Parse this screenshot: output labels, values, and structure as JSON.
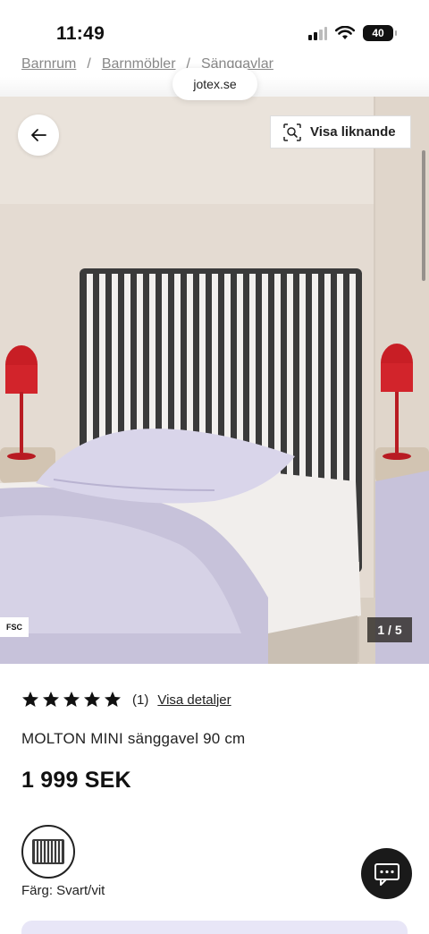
{
  "status_bar": {
    "time": "11:49",
    "battery": "40",
    "battery_level": 0.4
  },
  "breadcrumb": {
    "items": [
      "Barnrum",
      "Barnmöbler",
      "Sänggavlar"
    ],
    "separator": "/"
  },
  "browser": {
    "url": "jotex.se"
  },
  "gallery": {
    "similar_label": "Visa liknande",
    "badge": "FSC",
    "counter": "1 / 5",
    "current_image": 1,
    "total_images": 5
  },
  "product": {
    "rating_stars": 5,
    "review_count": "(1)",
    "details_link": "Visa detaljer",
    "name": "MOLTON MINI sänggavel 90 cm",
    "price": "1 999 SEK",
    "color_label": "Färg: Svart/vit"
  },
  "icons": {
    "back": "arrow-left-icon",
    "similar": "visual-search-icon",
    "chat": "chat-icon",
    "star": "star-icon",
    "signal": "signal-icon",
    "wifi": "wifi-icon",
    "battery": "battery-icon"
  },
  "colors": {
    "accent": "#1a1a1a",
    "star": "#111111",
    "bottom_bar": "#e8e6f7",
    "lamp": "#d1262e"
  }
}
